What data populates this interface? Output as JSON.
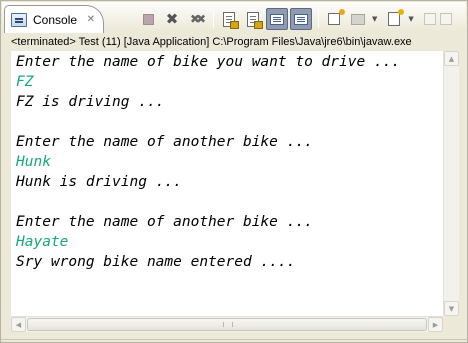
{
  "tab": {
    "title": "Console",
    "icon": "console-icon",
    "close_icon": "close-icon"
  },
  "toolbar": {
    "buttons": [
      {
        "name": "terminate-button",
        "icon": "stop-icon",
        "enabled": false
      },
      {
        "name": "remove-launch-button",
        "icon": "remove-x-icon",
        "enabled": true
      },
      {
        "name": "remove-all-terminated-button",
        "icon": "remove-all-x-icon",
        "enabled": true
      },
      {
        "name": "clear-console-button",
        "icon": "clear-document-icon",
        "enabled": true
      },
      {
        "name": "scroll-lock-button",
        "icon": "scroll-lock-icon",
        "enabled": true
      },
      {
        "name": "show-console-stdout-button",
        "icon": "show-stdout-icon",
        "pressed": true
      },
      {
        "name": "show-console-stderr-button",
        "icon": "show-stderr-icon",
        "pressed": true
      },
      {
        "name": "pin-console-button",
        "icon": "pin-icon",
        "enabled": true
      },
      {
        "name": "display-selected-console-button",
        "icon": "display-console-icon",
        "enabled": false
      },
      {
        "name": "open-console-button",
        "icon": "open-console-icon",
        "enabled": true
      }
    ]
  },
  "process_label": "<terminated> Test (11) [Java Application] C:\\Program Files\\Java\\jre6\\bin\\javaw.exe",
  "console": {
    "lines": [
      {
        "text": "Enter the name of bike you want to drive ...",
        "kind": "output"
      },
      {
        "text": "FZ",
        "kind": "input"
      },
      {
        "text": "FZ is driving ...",
        "kind": "output"
      },
      {
        "text": "",
        "kind": "output"
      },
      {
        "text": "Enter the name of another bike ...",
        "kind": "output"
      },
      {
        "text": "Hunk",
        "kind": "input"
      },
      {
        "text": "Hunk is driving ...",
        "kind": "output"
      },
      {
        "text": "",
        "kind": "output"
      },
      {
        "text": "Enter the name of another bike ...",
        "kind": "output"
      },
      {
        "text": "Hayate",
        "kind": "input"
      },
      {
        "text": "Sry wrong bike name entered ....",
        "kind": "output"
      }
    ]
  },
  "colors": {
    "output_text": "#000000",
    "input_text": "#16a878",
    "pressed_button": "#8e9bb0"
  }
}
